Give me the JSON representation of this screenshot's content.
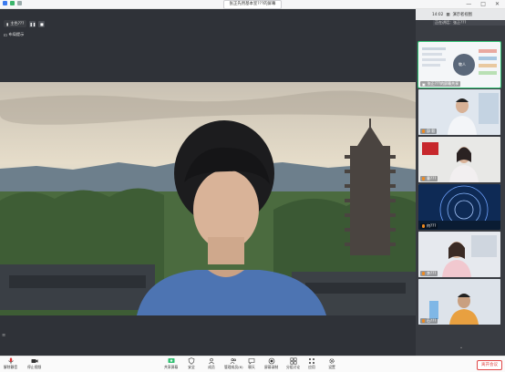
{
  "window": {
    "title": "张正先用基本室???的屏幕",
    "controls": [
      "—",
      "□",
      "✕"
    ]
  },
  "main": {
    "network_label": "主色???",
    "layout_label": "布局提示",
    "pause_label": "❚❚",
    "stop_label": "■"
  },
  "panel": {
    "time": "14:02",
    "view_label": "演示者视图",
    "subtitle": "正在讲话：张正???",
    "items": [
      {
        "name": "张正???的屏幕共享",
        "kind": "screen"
      },
      {
        "name": "邱  毅",
        "kind": "man"
      },
      {
        "name": "曹???",
        "kind": "woman"
      },
      {
        "name": "何???",
        "kind": "stars"
      },
      {
        "name": "李???",
        "kind": "woman2"
      },
      {
        "name": "石???",
        "kind": "man2"
      }
    ],
    "share_badge": "敬人",
    "collapse_label": "⌄"
  },
  "toolbar": {
    "left": [
      {
        "label": "解除静音",
        "icon": "microphone-icon"
      },
      {
        "label": "停止视频",
        "icon": "video-camera-icon"
      }
    ],
    "center": [
      {
        "label": "共享屏幕",
        "icon": "share-screen-icon"
      },
      {
        "label": "安全",
        "icon": "shield-icon"
      },
      {
        "label": "成员",
        "icon": "members-icon"
      },
      {
        "label": "管理成员(6)",
        "icon": "users-icon"
      },
      {
        "label": "聊天",
        "icon": "chat-icon"
      },
      {
        "label": "屏幕录制",
        "icon": "record-icon"
      },
      {
        "label": "分组讨论",
        "icon": "breakout-icon"
      },
      {
        "label": "应用",
        "icon": "apps-icon"
      },
      {
        "label": "设置",
        "icon": "gear-icon"
      }
    ],
    "end_label": "离开会议"
  },
  "colors": {
    "accent_green": "#2fbf71",
    "end_red": "#e04848",
    "dark_bg": "#2f3238"
  }
}
